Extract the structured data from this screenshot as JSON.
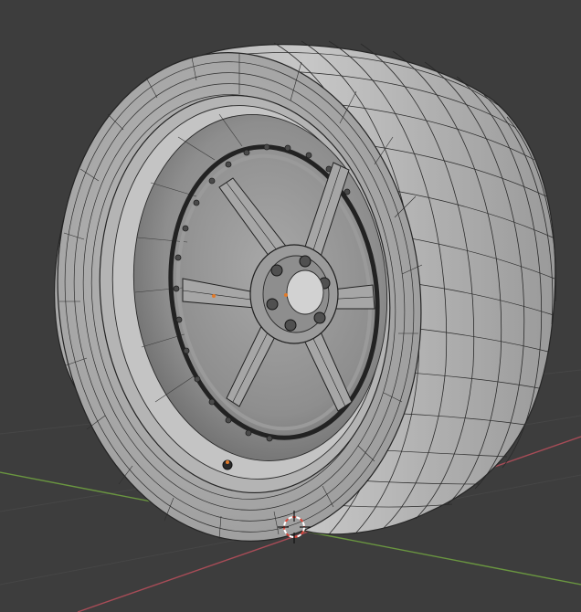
{
  "app": "Blender",
  "viewport": {
    "mode": "edit-mode-wireframe-overlay",
    "shading": "solid",
    "background_color": "#3d3d3d",
    "axes": {
      "x_axis_color": "#a84c57",
      "y_axis_color": "#6a9640"
    },
    "object": {
      "kind": "wheel",
      "parts": [
        "tire",
        "rim",
        "six-spoke-center",
        "lug-nuts",
        "center-cap",
        "rim-bolts",
        "valve-stem"
      ],
      "spoke_count": 6,
      "lug_count": 6,
      "surface_color": "#b9b9b9",
      "wire_color": "#202020"
    },
    "cursor": "3d-cursor-icon"
  }
}
